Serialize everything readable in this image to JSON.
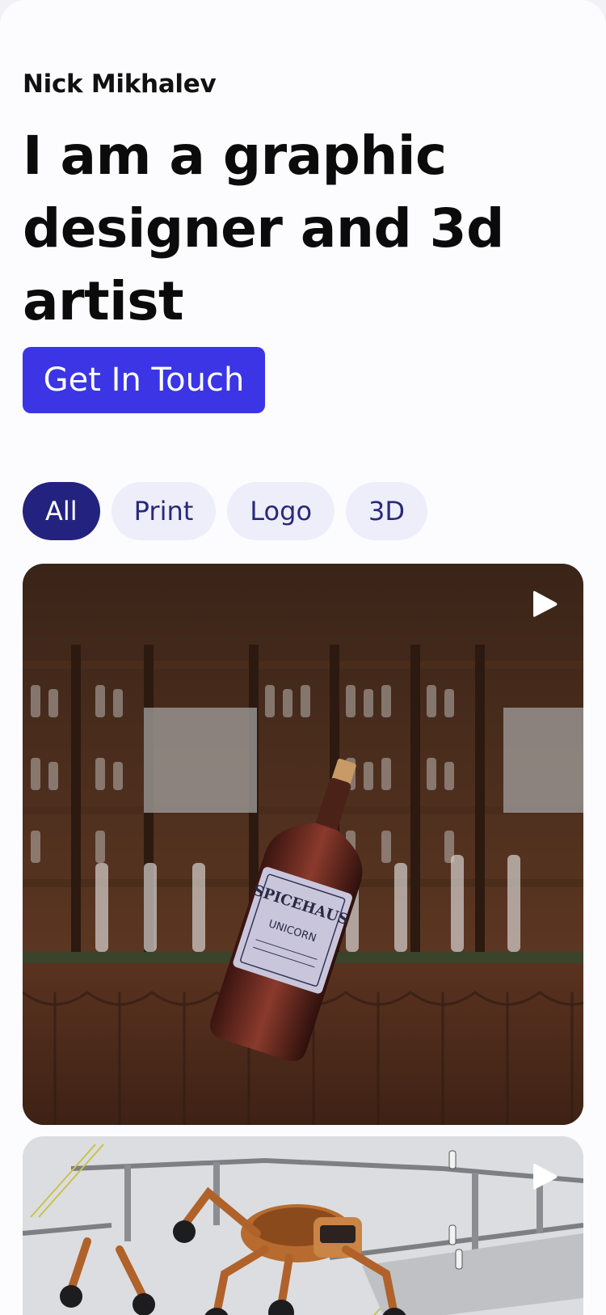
{
  "header": {
    "author_name": "Nick Mikhalev",
    "headline": "I am a graphic designer and 3d artist",
    "cta_label": "Get In Touch"
  },
  "filters": [
    {
      "label": "All",
      "active": true
    },
    {
      "label": "Print",
      "active": false
    },
    {
      "label": "Logo",
      "active": false
    },
    {
      "label": "3D",
      "active": false
    }
  ],
  "gallery": {
    "items": [
      {
        "icon": "play-icon",
        "label_text": "SPICEHAUS",
        "label_subtext": "UNICORN"
      },
      {
        "icon": "play-icon"
      }
    ]
  },
  "colors": {
    "accent": "#3b35e6",
    "chip_active": "#23237f",
    "chip_inactive": "#eeeefa",
    "chip_text": "#29297a"
  }
}
